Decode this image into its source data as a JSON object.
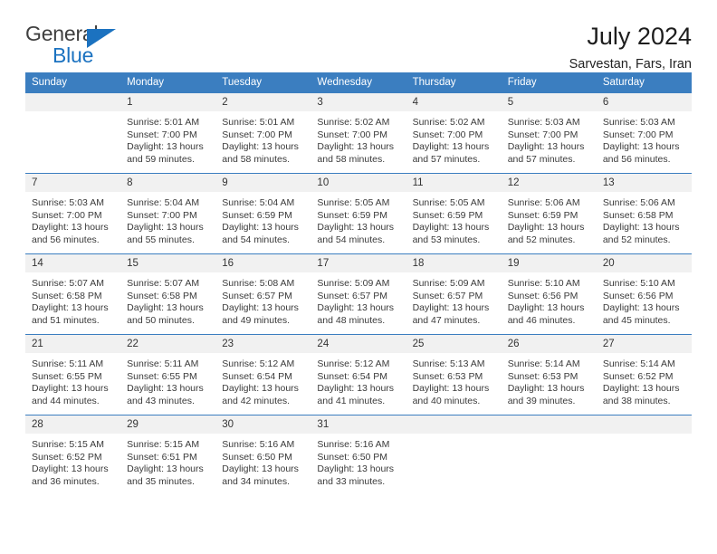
{
  "brand": {
    "line1": "General",
    "line2": "Blue",
    "accent_color": "#1b72c0",
    "text_color": "#3f3f3f"
  },
  "header": {
    "title": "July 2024",
    "subtitle": "Sarvestan, Fars, Iran"
  },
  "calendar": {
    "header_bg": "#3b7ec0",
    "daynum_bg": "#f1f1f1",
    "weekday_headers": [
      "Sunday",
      "Monday",
      "Tuesday",
      "Wednesday",
      "Thursday",
      "Friday",
      "Saturday"
    ],
    "weeks": [
      [
        {
          "day": "",
          "blank": true
        },
        {
          "day": "1",
          "sunrise": "Sunrise: 5:01 AM",
          "sunset": "Sunset: 7:00 PM",
          "daylight": "Daylight: 13 hours and 59 minutes."
        },
        {
          "day": "2",
          "sunrise": "Sunrise: 5:01 AM",
          "sunset": "Sunset: 7:00 PM",
          "daylight": "Daylight: 13 hours and 58 minutes."
        },
        {
          "day": "3",
          "sunrise": "Sunrise: 5:02 AM",
          "sunset": "Sunset: 7:00 PM",
          "daylight": "Daylight: 13 hours and 58 minutes."
        },
        {
          "day": "4",
          "sunrise": "Sunrise: 5:02 AM",
          "sunset": "Sunset: 7:00 PM",
          "daylight": "Daylight: 13 hours and 57 minutes."
        },
        {
          "day": "5",
          "sunrise": "Sunrise: 5:03 AM",
          "sunset": "Sunset: 7:00 PM",
          "daylight": "Daylight: 13 hours and 57 minutes."
        },
        {
          "day": "6",
          "sunrise": "Sunrise: 5:03 AM",
          "sunset": "Sunset: 7:00 PM",
          "daylight": "Daylight: 13 hours and 56 minutes."
        }
      ],
      [
        {
          "day": "7",
          "sunrise": "Sunrise: 5:03 AM",
          "sunset": "Sunset: 7:00 PM",
          "daylight": "Daylight: 13 hours and 56 minutes."
        },
        {
          "day": "8",
          "sunrise": "Sunrise: 5:04 AM",
          "sunset": "Sunset: 7:00 PM",
          "daylight": "Daylight: 13 hours and 55 minutes."
        },
        {
          "day": "9",
          "sunrise": "Sunrise: 5:04 AM",
          "sunset": "Sunset: 6:59 PM",
          "daylight": "Daylight: 13 hours and 54 minutes."
        },
        {
          "day": "10",
          "sunrise": "Sunrise: 5:05 AM",
          "sunset": "Sunset: 6:59 PM",
          "daylight": "Daylight: 13 hours and 54 minutes."
        },
        {
          "day": "11",
          "sunrise": "Sunrise: 5:05 AM",
          "sunset": "Sunset: 6:59 PM",
          "daylight": "Daylight: 13 hours and 53 minutes."
        },
        {
          "day": "12",
          "sunrise": "Sunrise: 5:06 AM",
          "sunset": "Sunset: 6:59 PM",
          "daylight": "Daylight: 13 hours and 52 minutes."
        },
        {
          "day": "13",
          "sunrise": "Sunrise: 5:06 AM",
          "sunset": "Sunset: 6:58 PM",
          "daylight": "Daylight: 13 hours and 52 minutes."
        }
      ],
      [
        {
          "day": "14",
          "sunrise": "Sunrise: 5:07 AM",
          "sunset": "Sunset: 6:58 PM",
          "daylight": "Daylight: 13 hours and 51 minutes."
        },
        {
          "day": "15",
          "sunrise": "Sunrise: 5:07 AM",
          "sunset": "Sunset: 6:58 PM",
          "daylight": "Daylight: 13 hours and 50 minutes."
        },
        {
          "day": "16",
          "sunrise": "Sunrise: 5:08 AM",
          "sunset": "Sunset: 6:57 PM",
          "daylight": "Daylight: 13 hours and 49 minutes."
        },
        {
          "day": "17",
          "sunrise": "Sunrise: 5:09 AM",
          "sunset": "Sunset: 6:57 PM",
          "daylight": "Daylight: 13 hours and 48 minutes."
        },
        {
          "day": "18",
          "sunrise": "Sunrise: 5:09 AM",
          "sunset": "Sunset: 6:57 PM",
          "daylight": "Daylight: 13 hours and 47 minutes."
        },
        {
          "day": "19",
          "sunrise": "Sunrise: 5:10 AM",
          "sunset": "Sunset: 6:56 PM",
          "daylight": "Daylight: 13 hours and 46 minutes."
        },
        {
          "day": "20",
          "sunrise": "Sunrise: 5:10 AM",
          "sunset": "Sunset: 6:56 PM",
          "daylight": "Daylight: 13 hours and 45 minutes."
        }
      ],
      [
        {
          "day": "21",
          "sunrise": "Sunrise: 5:11 AM",
          "sunset": "Sunset: 6:55 PM",
          "daylight": "Daylight: 13 hours and 44 minutes."
        },
        {
          "day": "22",
          "sunrise": "Sunrise: 5:11 AM",
          "sunset": "Sunset: 6:55 PM",
          "daylight": "Daylight: 13 hours and 43 minutes."
        },
        {
          "day": "23",
          "sunrise": "Sunrise: 5:12 AM",
          "sunset": "Sunset: 6:54 PM",
          "daylight": "Daylight: 13 hours and 42 minutes."
        },
        {
          "day": "24",
          "sunrise": "Sunrise: 5:12 AM",
          "sunset": "Sunset: 6:54 PM",
          "daylight": "Daylight: 13 hours and 41 minutes."
        },
        {
          "day": "25",
          "sunrise": "Sunrise: 5:13 AM",
          "sunset": "Sunset: 6:53 PM",
          "daylight": "Daylight: 13 hours and 40 minutes."
        },
        {
          "day": "26",
          "sunrise": "Sunrise: 5:14 AM",
          "sunset": "Sunset: 6:53 PM",
          "daylight": "Daylight: 13 hours and 39 minutes."
        },
        {
          "day": "27",
          "sunrise": "Sunrise: 5:14 AM",
          "sunset": "Sunset: 6:52 PM",
          "daylight": "Daylight: 13 hours and 38 minutes."
        }
      ],
      [
        {
          "day": "28",
          "sunrise": "Sunrise: 5:15 AM",
          "sunset": "Sunset: 6:52 PM",
          "daylight": "Daylight: 13 hours and 36 minutes."
        },
        {
          "day": "29",
          "sunrise": "Sunrise: 5:15 AM",
          "sunset": "Sunset: 6:51 PM",
          "daylight": "Daylight: 13 hours and 35 minutes."
        },
        {
          "day": "30",
          "sunrise": "Sunrise: 5:16 AM",
          "sunset": "Sunset: 6:50 PM",
          "daylight": "Daylight: 13 hours and 34 minutes."
        },
        {
          "day": "31",
          "sunrise": "Sunrise: 5:16 AM",
          "sunset": "Sunset: 6:50 PM",
          "daylight": "Daylight: 13 hours and 33 minutes."
        },
        {
          "day": "",
          "blank": true
        },
        {
          "day": "",
          "blank": true
        },
        {
          "day": "",
          "blank": true
        }
      ]
    ]
  }
}
